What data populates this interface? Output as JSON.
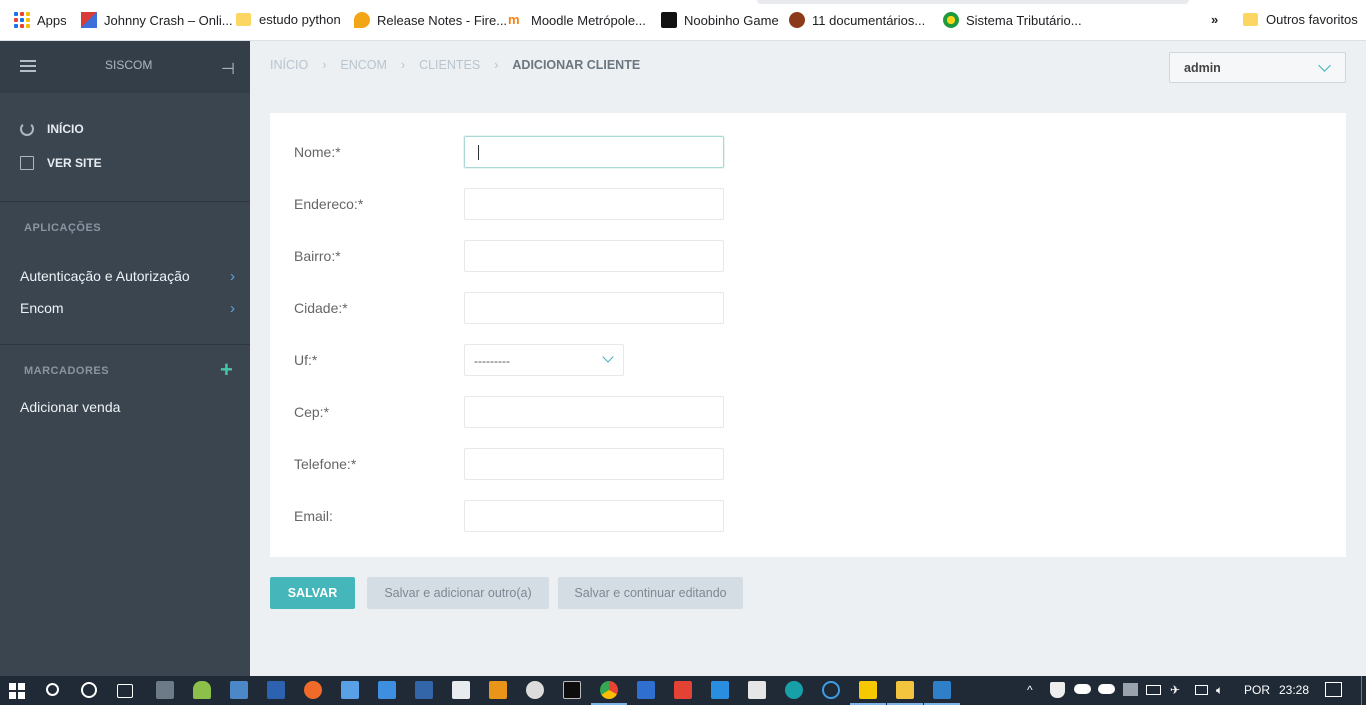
{
  "bookmarks": {
    "items": [
      {
        "label": "Apps",
        "icon": "apps-grid-icon"
      },
      {
        "label": "Johnny Crash – Onli...",
        "icon": "site-icon"
      },
      {
        "label": "estudo python",
        "icon": "folder-icon"
      },
      {
        "label": "Release Notes - Fire...",
        "icon": "flame-icon"
      },
      {
        "label": "Moodle Metrópole...",
        "icon": "moodle-icon"
      },
      {
        "label": "Noobinho Game",
        "icon": "game-icon"
      },
      {
        "label": "11 documentários...",
        "icon": "ball-icon"
      },
      {
        "label": "Sistema Tributário...",
        "icon": "brazil-icon"
      }
    ],
    "more": "»",
    "other_folder": "Outros favoritos"
  },
  "sidebar": {
    "brand": "SISCOM",
    "links": [
      {
        "label": "INÍCIO"
      },
      {
        "label": "VER SITE"
      }
    ],
    "apps_title": "APLICAÇÕES",
    "apps": [
      {
        "label": "Autenticação e Autorização"
      },
      {
        "label": "Encom"
      }
    ],
    "bookmarks_title": "MARCADORES",
    "bookmark_items": [
      {
        "label": "Adicionar venda"
      }
    ]
  },
  "header": {
    "breadcrumb": [
      "INÍCIO",
      "ENCOM",
      "CLIENTES",
      "ADICIONAR CLIENTE"
    ],
    "user": "admin"
  },
  "form": {
    "fields": [
      {
        "label": "Nome:*",
        "value": ""
      },
      {
        "label": "Endereco:*",
        "value": ""
      },
      {
        "label": "Bairro:*",
        "value": ""
      },
      {
        "label": "Cidade:*",
        "value": ""
      },
      {
        "label": "Uf:*",
        "value": "---------"
      },
      {
        "label": "Cep:*",
        "value": ""
      },
      {
        "label": "Telefone:*",
        "value": ""
      },
      {
        "label": "Email:",
        "value": ""
      }
    ],
    "buttons": {
      "save": "SALVAR",
      "save_add": "Salvar e adicionar outro(a)",
      "save_continue": "Salvar e continuar editando"
    }
  },
  "taskbar": {
    "language": "POR",
    "time": "23:28"
  },
  "colors": {
    "sidebar_bg": "#3a4550",
    "accent": "#45b6b9",
    "secondary_button": "#d5dde4"
  }
}
